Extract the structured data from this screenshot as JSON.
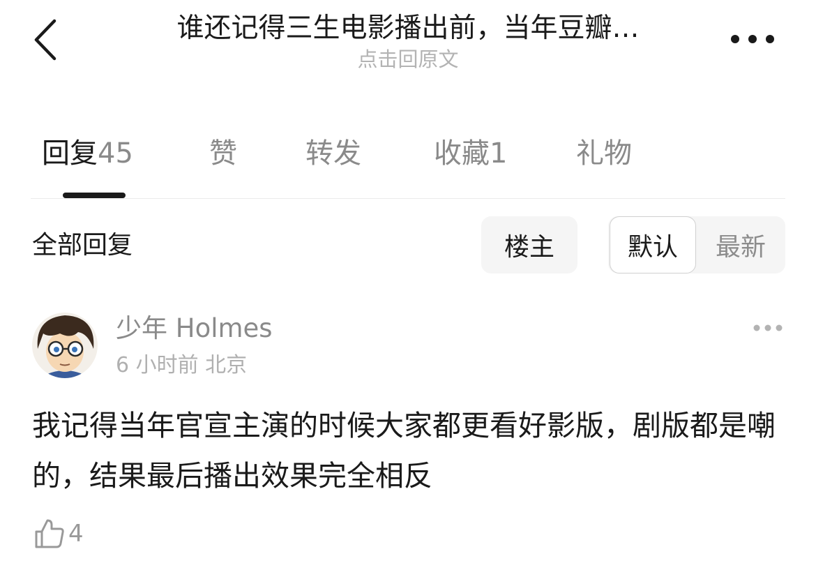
{
  "header": {
    "title": "谁还记得三生电影播出前，当年豆瓣…",
    "subtitle": "点击回原文"
  },
  "tabs": [
    {
      "label": "回复",
      "count": "45"
    },
    {
      "label": "赞",
      "count": ""
    },
    {
      "label": "转发",
      "count": ""
    },
    {
      "label": "收藏",
      "count": "1"
    },
    {
      "label": "礼物",
      "count": ""
    }
  ],
  "section": {
    "title": "全部回复",
    "op_filter": "楼主",
    "sort_default": "默认",
    "sort_latest": "最新"
  },
  "comment": {
    "author": "少年 Holmes",
    "meta": "6 小时前 北京",
    "text": "我记得当年官宣主演的时候大家都更看好影版，剧版都是嘲的，结果最后播出效果完全相反",
    "likes": "4"
  }
}
